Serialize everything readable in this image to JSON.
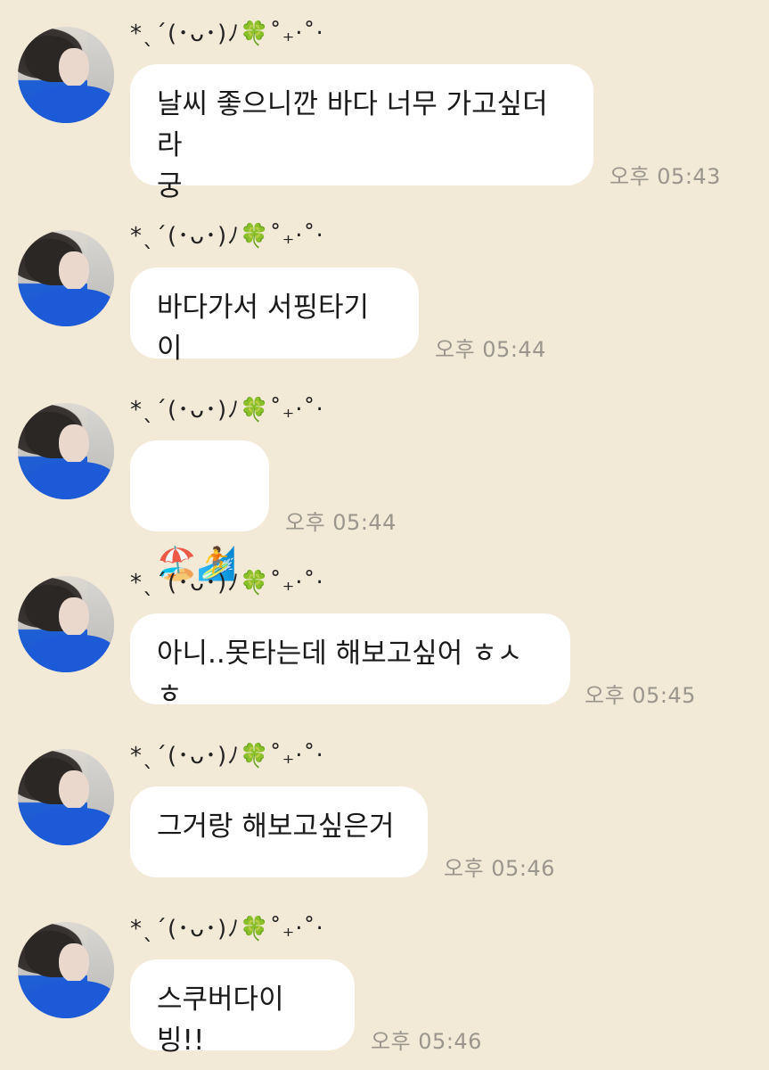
{
  "sender": {
    "name": "*ˎˊ(･ᴗ･)ﾉ🍀˚₊‧˚‧"
  },
  "messages": [
    {
      "text": "날씨 좋으니깐 바다 너무 가고싶더라\n궁",
      "time": "오후 05:43"
    },
    {
      "text": "바다가서 서핑타기이",
      "time": "오후 05:44"
    },
    {
      "text": "🏖️🏄",
      "time": "오후 05:44"
    },
    {
      "text": "아니..못타는데 해보고싶어 ㅎㅅㅎ",
      "time": "오후 05:45"
    },
    {
      "text": "그거랑 해보고싶은거",
      "time": "오후 05:46"
    },
    {
      "text": "스쿠버다이빙!!",
      "time": "오후 05:46"
    }
  ]
}
